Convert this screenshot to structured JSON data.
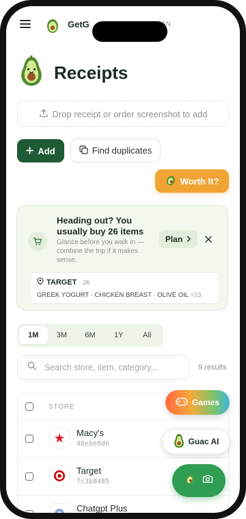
{
  "app": {
    "brand_name": "GetG",
    "brand_sub": "MAN",
    "page_title": "Receipts"
  },
  "dropzone": {
    "label": "Drop receipt or order screenshot to add"
  },
  "actions": {
    "add_label": "Add",
    "find_duplicates_label": "Find duplicates",
    "worth_it_label": "Worth It?"
  },
  "tip": {
    "title": "Heading out? You usually buy 26 items",
    "description": "Glance before you walk in — combine the trip if it makes sense.",
    "plan_label": "Plan",
    "store": {
      "name": "TARGET",
      "count": "26",
      "items_text": "GREEK YOGURT · CHICKEN BREAST · OLIVE OIL",
      "more": "+23"
    }
  },
  "range_tabs": {
    "items": [
      "1M",
      "3M",
      "6M",
      "1Y",
      "All"
    ],
    "active": "1M"
  },
  "search": {
    "placeholder": "Search store, item, category...",
    "results_label": "9 results"
  },
  "table": {
    "store_header": "STORE",
    "rows": [
      {
        "name": "Macy's",
        "hash": "48ebe6d6"
      },
      {
        "name": "Target",
        "hash": "7c3b8485"
      },
      {
        "name": "Chatgpt Plus",
        "hash": ""
      }
    ]
  },
  "fabs": {
    "games_label": "Games",
    "guac_label": "Guac AI"
  },
  "colors": {
    "primary_green": "#1e5a35",
    "accent_orange": "#f0a433",
    "fab_green": "#2f9e52",
    "tip_bg": "#f3f8ef"
  },
  "icons": {
    "menu": "hamburger-icon",
    "avocado": "avocado-icon",
    "upload": "upload-icon",
    "plus": "plus-icon",
    "duplicate": "copy-icon",
    "cart": "cart-icon",
    "chevron": "chevron-right-icon",
    "close": "close-icon",
    "location": "map-pin-icon",
    "search": "search-icon",
    "gamepad": "gamepad-icon",
    "camera": "camera-icon"
  }
}
